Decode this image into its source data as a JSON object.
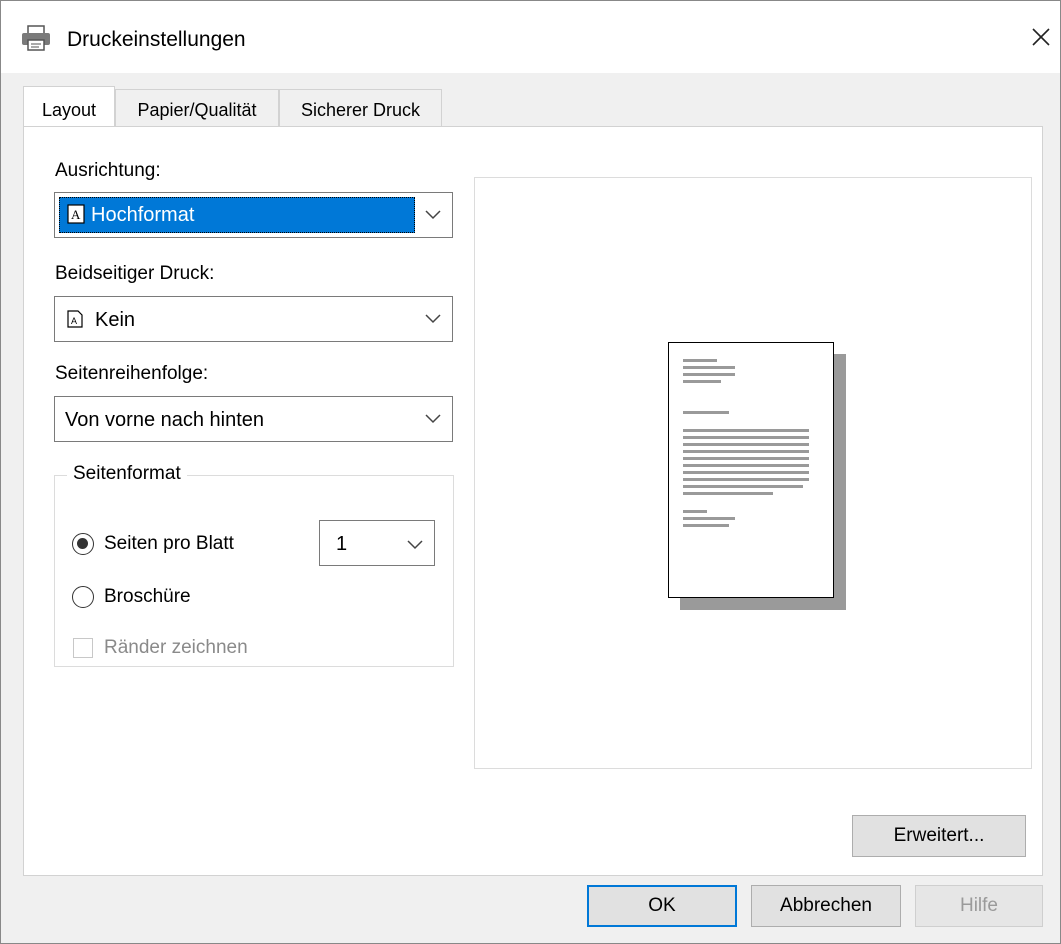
{
  "window": {
    "title": "Druckeinstellungen"
  },
  "tabs": [
    {
      "label": "Layout"
    },
    {
      "label": "Papier/Qualität"
    },
    {
      "label": "Sicherer Druck"
    }
  ],
  "layout": {
    "orientation": {
      "label": "Ausrichtung:",
      "value": "Hochformat"
    },
    "duplex": {
      "label": "Beidseitiger Druck:",
      "value": "Kein"
    },
    "page_order": {
      "label": "Seitenreihenfolge:",
      "value": "Von vorne nach hinten"
    },
    "page_format": {
      "title": "Seitenformat",
      "pages_per_sheet": {
        "label": "Seiten pro Blatt",
        "value": "1",
        "checked": true
      },
      "booklet": {
        "label": "Broschüre",
        "checked": false
      },
      "draw_borders": {
        "label": "Ränder zeichnen",
        "checked": false,
        "enabled": false
      }
    }
  },
  "buttons": {
    "advanced": "Erweitert...",
    "ok": "OK",
    "cancel": "Abbrechen",
    "help": "Hilfe"
  },
  "colors": {
    "accent": "#0078d7"
  }
}
